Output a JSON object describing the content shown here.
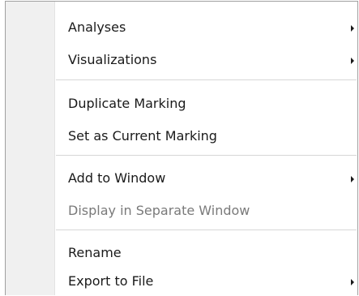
{
  "menu": {
    "items": [
      {
        "label": "Analyses",
        "has_submenu": true,
        "enabled": true
      },
      {
        "label": "Visualizations",
        "has_submenu": true,
        "enabled": true
      },
      {
        "label": "Duplicate Marking",
        "has_submenu": false,
        "enabled": true
      },
      {
        "label": "Set as Current Marking",
        "has_submenu": false,
        "enabled": true
      },
      {
        "label": "Add to Window",
        "has_submenu": true,
        "enabled": true
      },
      {
        "label": "Display in Separate Window",
        "has_submenu": false,
        "enabled": false
      },
      {
        "label": "Rename",
        "has_submenu": false,
        "enabled": true
      },
      {
        "label": "Export to File",
        "has_submenu": true,
        "enabled": true
      }
    ]
  }
}
